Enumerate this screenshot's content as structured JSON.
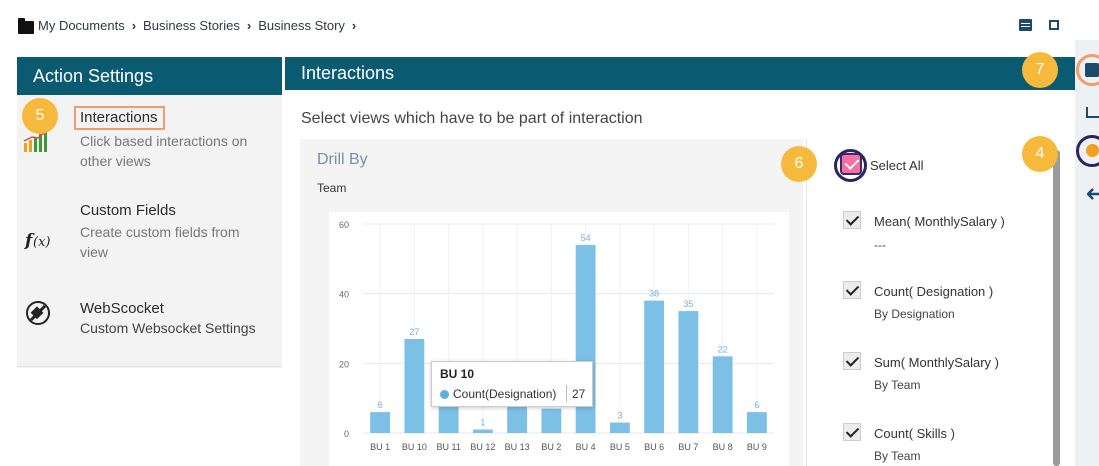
{
  "breadcrumb": [
    "My Documents",
    "Business Stories",
    "Business Story"
  ],
  "breadcrumb_sep": "›",
  "left_panel": {
    "title": "Action Settings",
    "items": [
      {
        "title": "Interactions",
        "desc": "Click based interactions on other views",
        "icon": "bar-chart-icon"
      },
      {
        "title": "Custom Fields",
        "desc": "Create custom fields from view",
        "icon": "function-fx-icon"
      },
      {
        "title": "WebScocket",
        "desc": "Custom Websocket Settings",
        "icon": "websocket-plug-icon"
      }
    ]
  },
  "main": {
    "title": "Interactions",
    "instruction": "Select views which have to be part of interaction",
    "view": {
      "title": "Drill By",
      "subtitle": "Team"
    }
  },
  "chart_data": {
    "type": "bar",
    "categories": [
      "BU 1",
      "BU 10",
      "BU 11",
      "BU 12",
      "BU 13",
      "BU 2",
      "BU 4",
      "BU 5",
      "BU 6",
      "BU 7",
      "BU 8",
      "BU 9"
    ],
    "series": [
      {
        "name": "Count(Designation)",
        "values": [
          6,
          27,
          12,
          1,
          11,
          7,
          54,
          3,
          38,
          35,
          22,
          6
        ]
      }
    ],
    "data_labels": [
      "6",
      "27",
      "",
      "1",
      "",
      "",
      "54",
      "3",
      "38",
      "35",
      "22",
      "6"
    ],
    "yticks": [
      0,
      20,
      40,
      60
    ],
    "ylim": [
      0,
      60
    ],
    "color": "#7cc0e6",
    "tooltip": {
      "title": "BU 10",
      "label": "Count(Designation)",
      "value": "27"
    }
  },
  "select_all": {
    "label": "Select All",
    "checked": true
  },
  "options": [
    {
      "label": "Mean( MonthlySalary )",
      "sub": "---",
      "checked": true
    },
    {
      "label": "Count( Designation )",
      "sub": "By Designation",
      "checked": true
    },
    {
      "label": "Sum( MonthlySalary )",
      "sub": "By Team",
      "checked": true
    },
    {
      "label": "Count( Skills )",
      "sub": "By Team",
      "checked": true
    }
  ],
  "badges": {
    "b5": "5",
    "b6": "6",
    "b7": "7",
    "b4": "4"
  },
  "colors": {
    "header": "#0a5a72",
    "accent": "#f6b93b",
    "highlight": "#f29c6e",
    "ring": "#2c2360"
  }
}
